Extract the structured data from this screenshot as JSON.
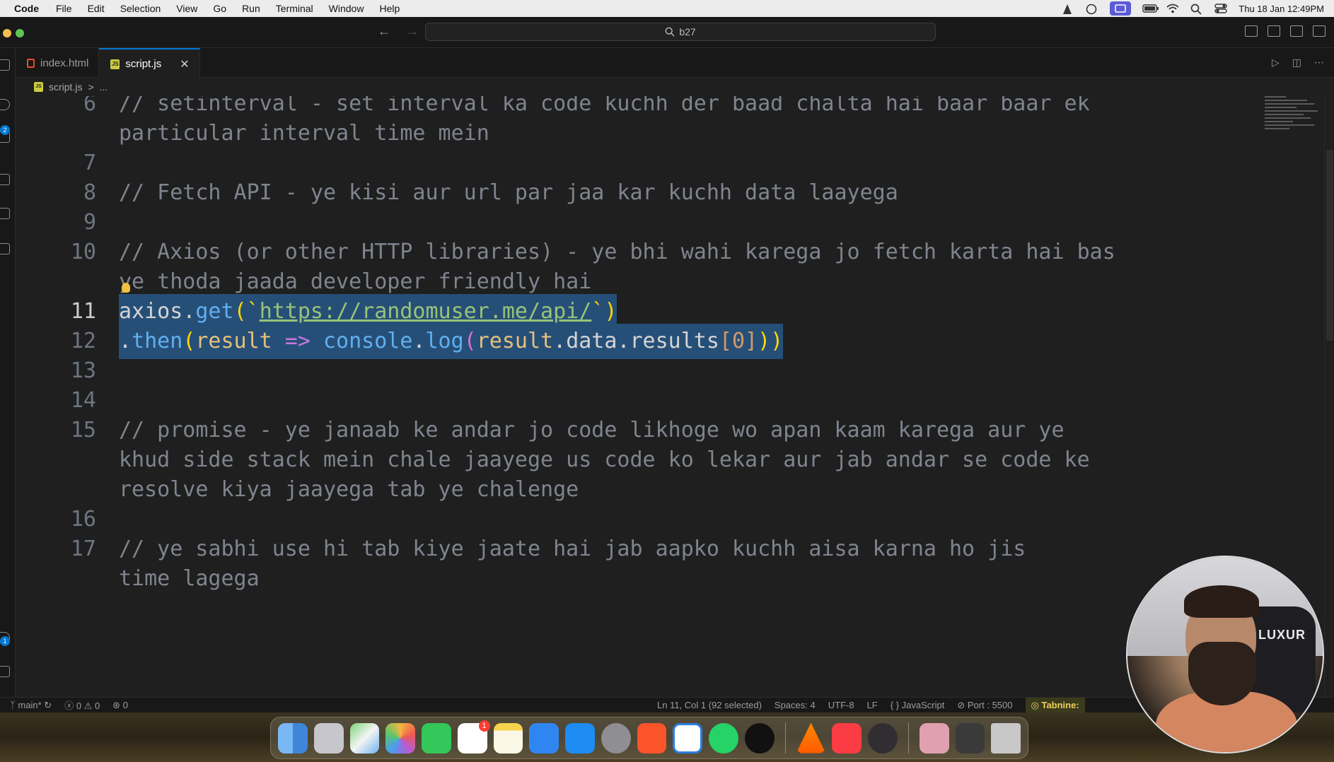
{
  "menubar": {
    "app": "Code",
    "items": [
      "File",
      "Edit",
      "Selection",
      "View",
      "Go",
      "Run",
      "Terminal",
      "Window",
      "Help"
    ],
    "datetime": "Thu 18 Jan  12:49PM"
  },
  "titlebar": {
    "search_text": "b27"
  },
  "tabs": [
    {
      "label": "index.html",
      "icon": "html-file-icon"
    },
    {
      "label": "script.js",
      "icon": "js-file-icon"
    }
  ],
  "breadcrumb": {
    "file": "script.js",
    "separator": ">",
    "rest": "..."
  },
  "activity_badge": "2",
  "activity_badge2": "1",
  "editor": {
    "lines": [
      {
        "num": "6",
        "text": "// setinterval - set interval ka code kuchh der baad chalta hai baar baar ek",
        "cont": "particular interval time mein"
      },
      {
        "num": "7",
        "text": ""
      },
      {
        "num": "8",
        "text": "// Fetch API - ye kisi aur url par jaa kar kuchh data laayega"
      },
      {
        "num": "9",
        "text": ""
      },
      {
        "num": "10",
        "text": "// Axios (or other HTTP libraries) - ye bhi wahi karega jo fetch karta hai bas",
        "cont": "ye thoda jaada developer friendly hai"
      },
      {
        "num": "11",
        "axios": "axios",
        "dot": ".",
        "get": "get",
        "open": "(`",
        "url": "https://randomuser.me/api/",
        "close": "`)"
      },
      {
        "num": "12",
        "dot": ".",
        "then": "then",
        "p1": "(",
        "result": "result",
        "arrow": " => ",
        "console": "console",
        "log": "log",
        "p2": "(",
        "result2": "result",
        "data": "data",
        "results": "results",
        "idx": "[0]",
        "end": "))"
      },
      {
        "num": "13",
        "text": ""
      },
      {
        "num": "14",
        "text": ""
      },
      {
        "num": "15",
        "text": "// promise - ye janaab ke andar jo code likhoge wo apan kaam karega aur ye",
        "cont": "khud side stack mein chale jaayege us code ko lekar aur jab andar se code ke",
        "cont2": "resolve kiya jaayega tab ye chalenge"
      },
      {
        "num": "16",
        "text": ""
      },
      {
        "num": "17",
        "text": "// ye sabhi use hi tab kiye jaate hai jab aapko kuchh aisa karna ho jis",
        "cont": "time lagega"
      }
    ]
  },
  "statusbar": {
    "branch": "main*",
    "errors": "0",
    "warnings": "0",
    "ports": "0",
    "position": "Ln 11, Col 1 (92 selected)",
    "spaces": "Spaces: 4",
    "encoding": "UTF-8",
    "eol": "LF",
    "language": "JavaScript",
    "port": "Port : 5500",
    "tabnine": "Tabnine:"
  },
  "webcam": {
    "chair_text": "LUXUR"
  },
  "dock": {
    "apps": [
      "finder-icon",
      "launchpad-icon",
      "maps-icon",
      "photos-icon",
      "facetime-icon",
      "reminders-icon",
      "notes-icon",
      "keynote-icon",
      "app-store-icon",
      "system-settings-icon",
      "brave-icon",
      "vscode-icon",
      "whatsapp-icon",
      "github-icon",
      "vlc-icon",
      "music-icon",
      "obs-icon",
      "preview-icon",
      "screenshots-icon",
      "trash-icon"
    ],
    "reminders_badge": "1"
  }
}
